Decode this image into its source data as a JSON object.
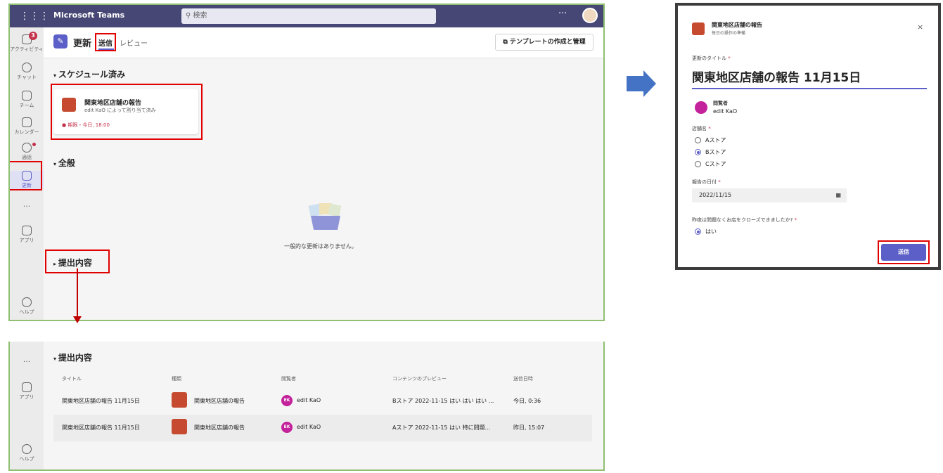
{
  "win1": {
    "app_title": "Microsoft Teams",
    "search_placeholder": "検索",
    "more": "···",
    "rail": {
      "activity": "アクティビティ",
      "activity_badge": "3",
      "chat": "チャット",
      "teams": "チーム",
      "calendar": "カレンダー",
      "calls": "通話",
      "updates": "更新",
      "more": "···",
      "apps": "アプリ",
      "help": "ヘルプ"
    },
    "app_name": "更新",
    "tabs": [
      "送信",
      "レビュー"
    ],
    "template_button": "テンプレートの作成と管理",
    "section_scheduled": "スケジュール済み",
    "card": {
      "title": "関東地区店舗の報告",
      "subtitle": "edit KaO によって割り当て済み",
      "due": "期限・今日, 18:00"
    },
    "section_general": "全般",
    "empty_text": "一般的な更新はありません。",
    "section_submitted": "提出内容"
  },
  "win2": {
    "rail": {
      "more": "···",
      "apps": "アプリ",
      "help": "ヘルプ"
    },
    "section_title": "提出内容",
    "columns": [
      "タイトル",
      "種類",
      "閲覧者",
      "コンテンツのプレビュー",
      "送信日時"
    ],
    "rows": [
      {
        "title": "関東地区店舗の報告 11月15日",
        "type": "関東地区店舗の報告",
        "avatar": "EK",
        "viewer": "edit KaO",
        "preview": "Bストア 2022-11-15 はい はい はい ...",
        "sent": "今日, 0:36"
      },
      {
        "title": "関東地区店舗の報告 11月15日",
        "type": "関東地区店舗の報告",
        "avatar": "EK",
        "viewer": "edit KaO",
        "preview": "Aストア 2022-11-15 はい 特に問題...",
        "sent": "昨日, 15:07"
      }
    ]
  },
  "dialog": {
    "title": "関東地区店舗の報告",
    "subtitle": "毎日の操作の準備",
    "close": "×",
    "field_title_label": "更新のタイトル",
    "title_value": "関東地区店舗の報告 11月15日",
    "viewer_label": "閲覧者",
    "viewer_name": "edit KaO",
    "store_label": "店舗名",
    "store_options": [
      "Aストア",
      "Bストア",
      "Cストア"
    ],
    "selected_store": "Bストア",
    "date_label": "報告の日付",
    "date_value": "2022/11/15",
    "question_label": "昨夜は問題なくお店をクローズできましたか?",
    "answer": "はい",
    "send": "送信",
    "required_mark": "*"
  },
  "colors": {
    "teams_purple": "#464775",
    "accent": "#5b5fc7",
    "highlight_red": "#e00000",
    "arrow_blue": "#4472c4",
    "app_red": "#c64a2f"
  }
}
